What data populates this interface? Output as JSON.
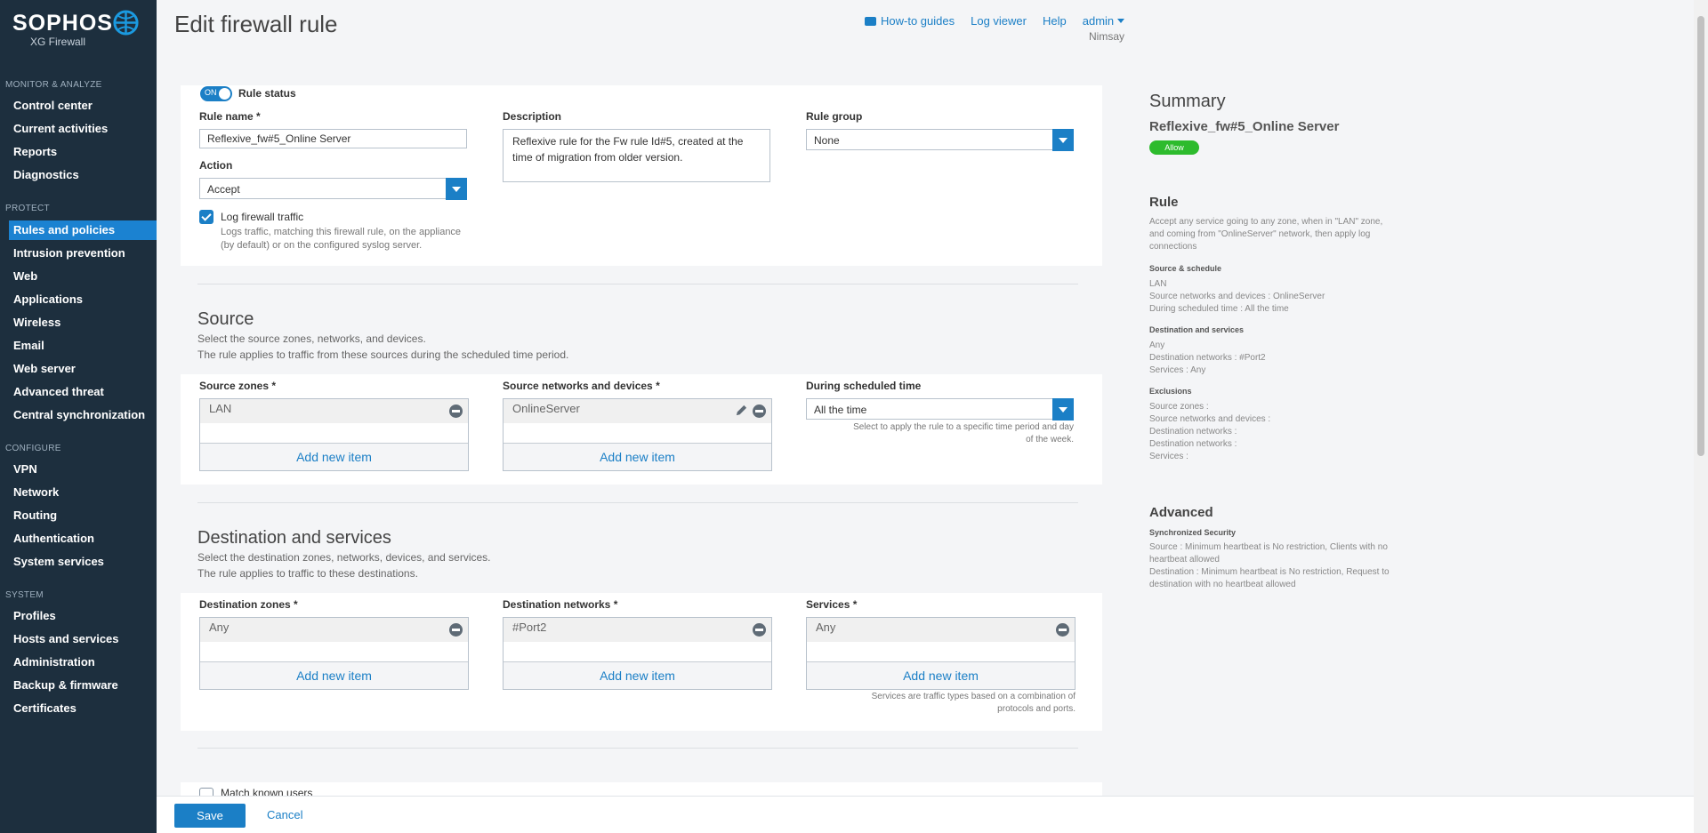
{
  "brand": {
    "name": "SOPHOS",
    "product": "XG Firewall"
  },
  "sidebar": {
    "sections": [
      {
        "title": "MONITOR & ANALYZE",
        "items": [
          "Control center",
          "Current activities",
          "Reports",
          "Diagnostics"
        ]
      },
      {
        "title": "PROTECT",
        "items": [
          "Rules and policies",
          "Intrusion prevention",
          "Web",
          "Applications",
          "Wireless",
          "Email",
          "Web server",
          "Advanced threat",
          "Central synchronization"
        ]
      },
      {
        "title": "CONFIGURE",
        "items": [
          "VPN",
          "Network",
          "Routing",
          "Authentication",
          "System services"
        ]
      },
      {
        "title": "SYSTEM",
        "items": [
          "Profiles",
          "Hosts and services",
          "Administration",
          "Backup & firmware",
          "Certificates"
        ]
      }
    ],
    "active_item": "Rules and policies"
  },
  "header": {
    "title": "Edit firewall rule",
    "links": {
      "howto": "How-to guides",
      "logviewer": "Log viewer",
      "help": "Help",
      "user": "admin"
    },
    "user_sub": "Nimsay"
  },
  "general": {
    "rule_status_toggle": "ON",
    "rule_status_label": "Rule status",
    "rule_name_label": "Rule name *",
    "rule_name_value": "Reflexive_fw#5_Online Server",
    "description_label": "Description",
    "description_value": "Reflexive rule for the Fw rule Id#5, created at the time of migration from older version.",
    "rule_group_label": "Rule group",
    "rule_group_value": "None",
    "action_label": "Action",
    "action_value": "Accept",
    "log_label": "Log firewall traffic",
    "log_note": "Logs traffic, matching this firewall rule, on the appliance (by default) or on the configured syslog server."
  },
  "source": {
    "title": "Source",
    "desc1": "Select the source zones, networks, and devices.",
    "desc2": "The rule applies to traffic from these sources during the scheduled time period.",
    "zones_label": "Source zones *",
    "zones_value": "LAN",
    "networks_label": "Source networks and devices *",
    "networks_value": "OnlineServer",
    "schedule_label": "During scheduled time",
    "schedule_value": "All the time",
    "schedule_note": "Select to apply the rule to a specific time period and day of the week.",
    "add_label": "Add new item"
  },
  "destination": {
    "title": "Destination and services",
    "desc1": "Select the destination zones, networks, devices, and services.",
    "desc2": "The rule applies to traffic to these destinations.",
    "zones_label": "Destination zones *",
    "zones_value": "Any",
    "networks_label": "Destination networks *",
    "networks_value": "#Port2",
    "services_label": "Services *",
    "services_value": "Any",
    "services_note": "Services are traffic types based on a combination of protocols and ports.",
    "add_label": "Add new item"
  },
  "match_users_label": "Match known users",
  "summary": {
    "title": "Summary",
    "rule_name": "Reflexive_fw#5_Online Server",
    "badge": "Allow",
    "rule_heading": "Rule",
    "rule_text": "Accept any service going to any zone, when in \"LAN\" zone, and coming from \"OnlineServer\" network, then apply log connections",
    "src_heading": "Source & schedule",
    "src_lines": [
      "LAN",
      "Source networks and devices : OnlineServer",
      "During scheduled time : All the time"
    ],
    "dst_heading": "Destination and services",
    "dst_lines": [
      "Any",
      "Destination networks : #Port2",
      "Services : Any"
    ],
    "exc_heading": "Exclusions",
    "exc_lines": [
      "Source zones :",
      "Source networks and devices :",
      "Destination networks :",
      "Destination networks :",
      "Services :"
    ],
    "adv_heading": "Advanced",
    "sync_heading": "Synchronized Security",
    "sync_lines": [
      "Source : Minimum heartbeat is No restriction, Clients with no heartbeat allowed",
      "Destination : Minimum heartbeat is No restriction, Request to destination with no heartbeat allowed"
    ]
  },
  "footer": {
    "save": "Save",
    "cancel": "Cancel"
  },
  "colors": {
    "accent": "#1b7fc6",
    "sidebar_bg": "#1d2f3e",
    "allow_badge": "#2dbb2d"
  }
}
